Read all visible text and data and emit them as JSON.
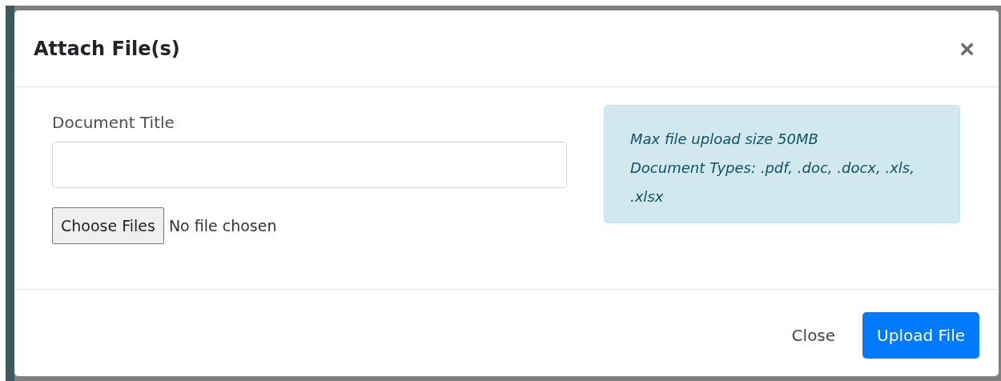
{
  "dialog": {
    "title": "Attach File(s)",
    "close_icon": "×"
  },
  "form": {
    "label": "Document Title",
    "file_button": "Choose Files",
    "file_status": "No file chosen"
  },
  "info": {
    "lines": [
      "Max file upload size 50MB",
      "Document Types: .pdf, .doc, .docx, .xls, .xlsx"
    ]
  },
  "buttons": [
    {
      "label": "Close",
      "kind": "secondary"
    },
    {
      "label": "Upload File",
      "kind": "primary"
    }
  ]
}
